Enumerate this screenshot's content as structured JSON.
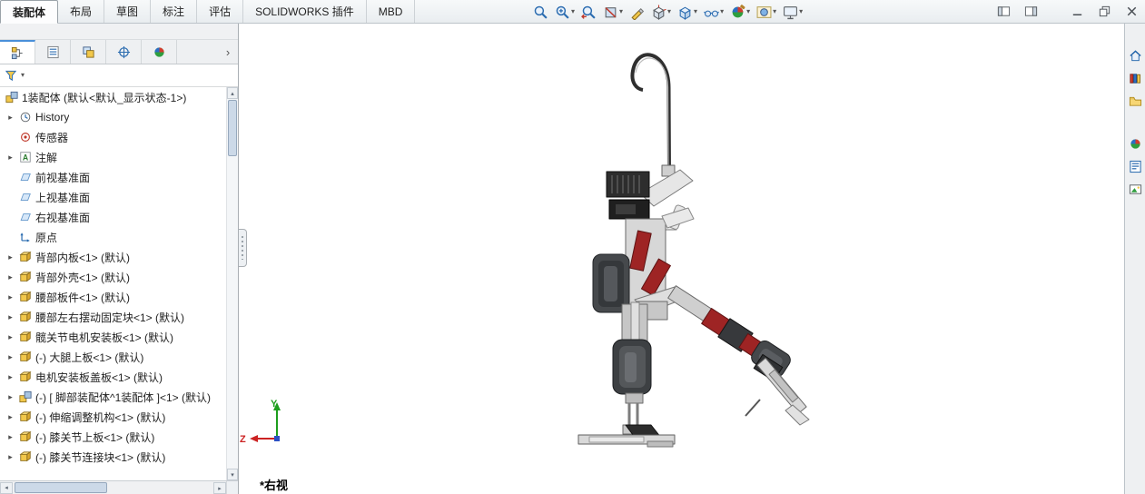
{
  "ribbon_tabs": [
    {
      "label": "装配体",
      "name": "assembly",
      "active": true
    },
    {
      "label": "布局",
      "name": "layout",
      "active": false
    },
    {
      "label": "草图",
      "name": "sketch",
      "active": false
    },
    {
      "label": "标注",
      "name": "markup",
      "active": false
    },
    {
      "label": "评估",
      "name": "evaluate",
      "active": false
    },
    {
      "label": "SOLIDWORKS 插件",
      "name": "solidworks-add-ins",
      "active": false
    },
    {
      "label": "MBD",
      "name": "mbd",
      "active": false
    }
  ],
  "view_toolbar": [
    {
      "name": "zoom-to-fit",
      "icon": "magnifier",
      "dropdown": false
    },
    {
      "name": "zoom-to-area",
      "icon": "magnifier-plus",
      "dropdown": true
    },
    {
      "name": "previous-view",
      "icon": "magnifier-back",
      "dropdown": false
    },
    {
      "name": "section-view",
      "icon": "section",
      "dropdown": true
    },
    {
      "name": "annotation-view",
      "icon": "pencil",
      "dropdown": false
    },
    {
      "name": "view-orientation",
      "icon": "cube-axes",
      "dropdown": true
    },
    {
      "name": "display-style",
      "icon": "cube",
      "dropdown": true
    },
    {
      "name": "hide-show-items",
      "icon": "glasses",
      "dropdown": true
    },
    {
      "name": "edit-appearance",
      "icon": "sphere-brush",
      "dropdown": true
    },
    {
      "name": "apply-scene",
      "icon": "sphere-scene",
      "dropdown": true
    },
    {
      "name": "view-settings",
      "icon": "monitor",
      "dropdown": true
    }
  ],
  "window_buttons": [
    "pane-left",
    "pane-right",
    "minimize",
    "restore",
    "close"
  ],
  "feature_tree": {
    "tabs": [
      "featuremanager",
      "propertymanager",
      "configurationmanager",
      "dimxpertmanager",
      "displaymanager"
    ],
    "root_label": "1装配体 (默认<默认_显示状态-1>)",
    "items": [
      {
        "label": "History",
        "icon": "history",
        "arrow": true
      },
      {
        "label": "传感器",
        "icon": "sensor",
        "arrow": false
      },
      {
        "label": "注解",
        "icon": "annotation",
        "arrow": true
      },
      {
        "label": "前视基准面",
        "icon": "plane",
        "arrow": false
      },
      {
        "label": "上视基准面",
        "icon": "plane",
        "arrow": false
      },
      {
        "label": "右视基准面",
        "icon": "plane",
        "arrow": false
      },
      {
        "label": "原点",
        "icon": "origin",
        "arrow": false
      },
      {
        "label": "背部内板<1> (默认)",
        "icon": "part",
        "arrow": true
      },
      {
        "label": "背部外壳<1> (默认)",
        "icon": "part",
        "arrow": true
      },
      {
        "label": "腰部板件<1> (默认)",
        "icon": "part",
        "arrow": true
      },
      {
        "label": "腰部左右摆动固定块<1> (默认)",
        "icon": "part",
        "arrow": true
      },
      {
        "label": "髋关节电机安装板<1> (默认)",
        "icon": "part",
        "arrow": true
      },
      {
        "label": "(-) 大腿上板<1> (默认)",
        "icon": "part",
        "arrow": true
      },
      {
        "label": "电机安装板盖板<1> (默认)",
        "icon": "part",
        "arrow": true
      },
      {
        "label": "(-) [ 脚部装配体^1装配体 ]<1> (默认)",
        "icon": "assembly",
        "arrow": true
      },
      {
        "label": "(-) 伸缩调整机构<1> (默认)",
        "icon": "part",
        "arrow": true
      },
      {
        "label": "(-) 膝关节上板<1> (默认)",
        "icon": "part",
        "arrow": true
      },
      {
        "label": "(-) 膝关节连接块<1> (默认)",
        "icon": "part",
        "arrow": true
      }
    ]
  },
  "task_pane": [
    "home",
    "design-library",
    "file-explorer",
    "appearances",
    "custom-properties",
    "view-palette"
  ],
  "viewport": {
    "view_label": "*右视",
    "triad": {
      "up": "Y",
      "left": "Z"
    }
  },
  "icons_glyphs": {
    "chevron": "▾",
    "expand": "▸",
    "up": "▴",
    "down": "▾",
    "left": "◂",
    "right": "▸",
    "overflow": "›"
  },
  "colors": {
    "accent": "#2b6cb0",
    "red_accent": "#9e2424",
    "canvas": "#ffffff",
    "panel": "#f0f1f3"
  }
}
